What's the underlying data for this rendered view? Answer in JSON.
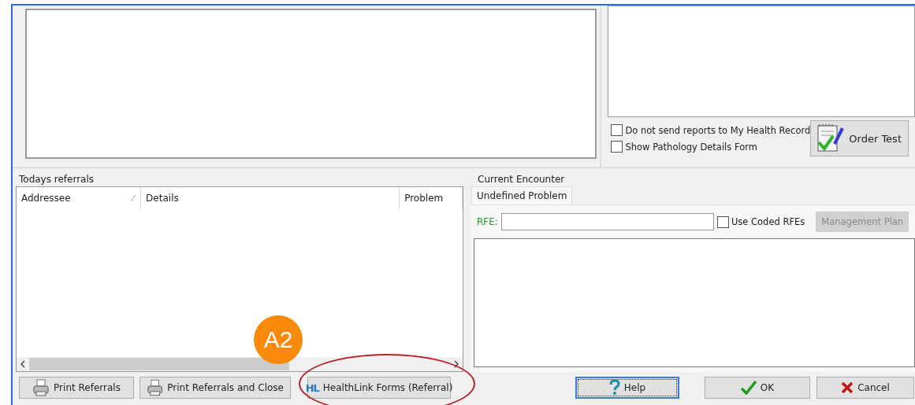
{
  "top_panel": {
    "checkboxes": [
      {
        "label": "Do not send reports to My Health Record",
        "checked": false
      },
      {
        "label": "Show Pathology Details Form",
        "checked": false
      }
    ],
    "order_test_button": "Order Test"
  },
  "todays_referrals": {
    "title": "Todays referrals",
    "columns": [
      "Addressee",
      "Details",
      "Problem"
    ]
  },
  "current_encounter": {
    "title": "Current Encounter",
    "tabs": [
      {
        "label": "Undefined Problem",
        "selected": true
      }
    ],
    "rfe_label": "RFE:",
    "use_coded_rfes": {
      "label": "Use Coded RFEs",
      "checked": false
    },
    "management_plan": {
      "label": "Management Plan",
      "disabled": true
    }
  },
  "buttons": [
    {
      "label": "Print Referrals",
      "kind": "printer",
      "focused": false
    },
    {
      "label": "Print Referrals and Close",
      "kind": "printer",
      "focused": false
    },
    {
      "label": "HealthLink Forms (Referral)",
      "kind": "healthlink",
      "logo": "HL",
      "focused": false
    },
    {
      "label": "Help",
      "kind": "help",
      "focused": true
    },
    {
      "label": "OK",
      "kind": "ok",
      "focused": false
    },
    {
      "label": "Cancel",
      "kind": "cancel",
      "focused": false
    }
  ],
  "annotation": {
    "badge": "A2"
  }
}
